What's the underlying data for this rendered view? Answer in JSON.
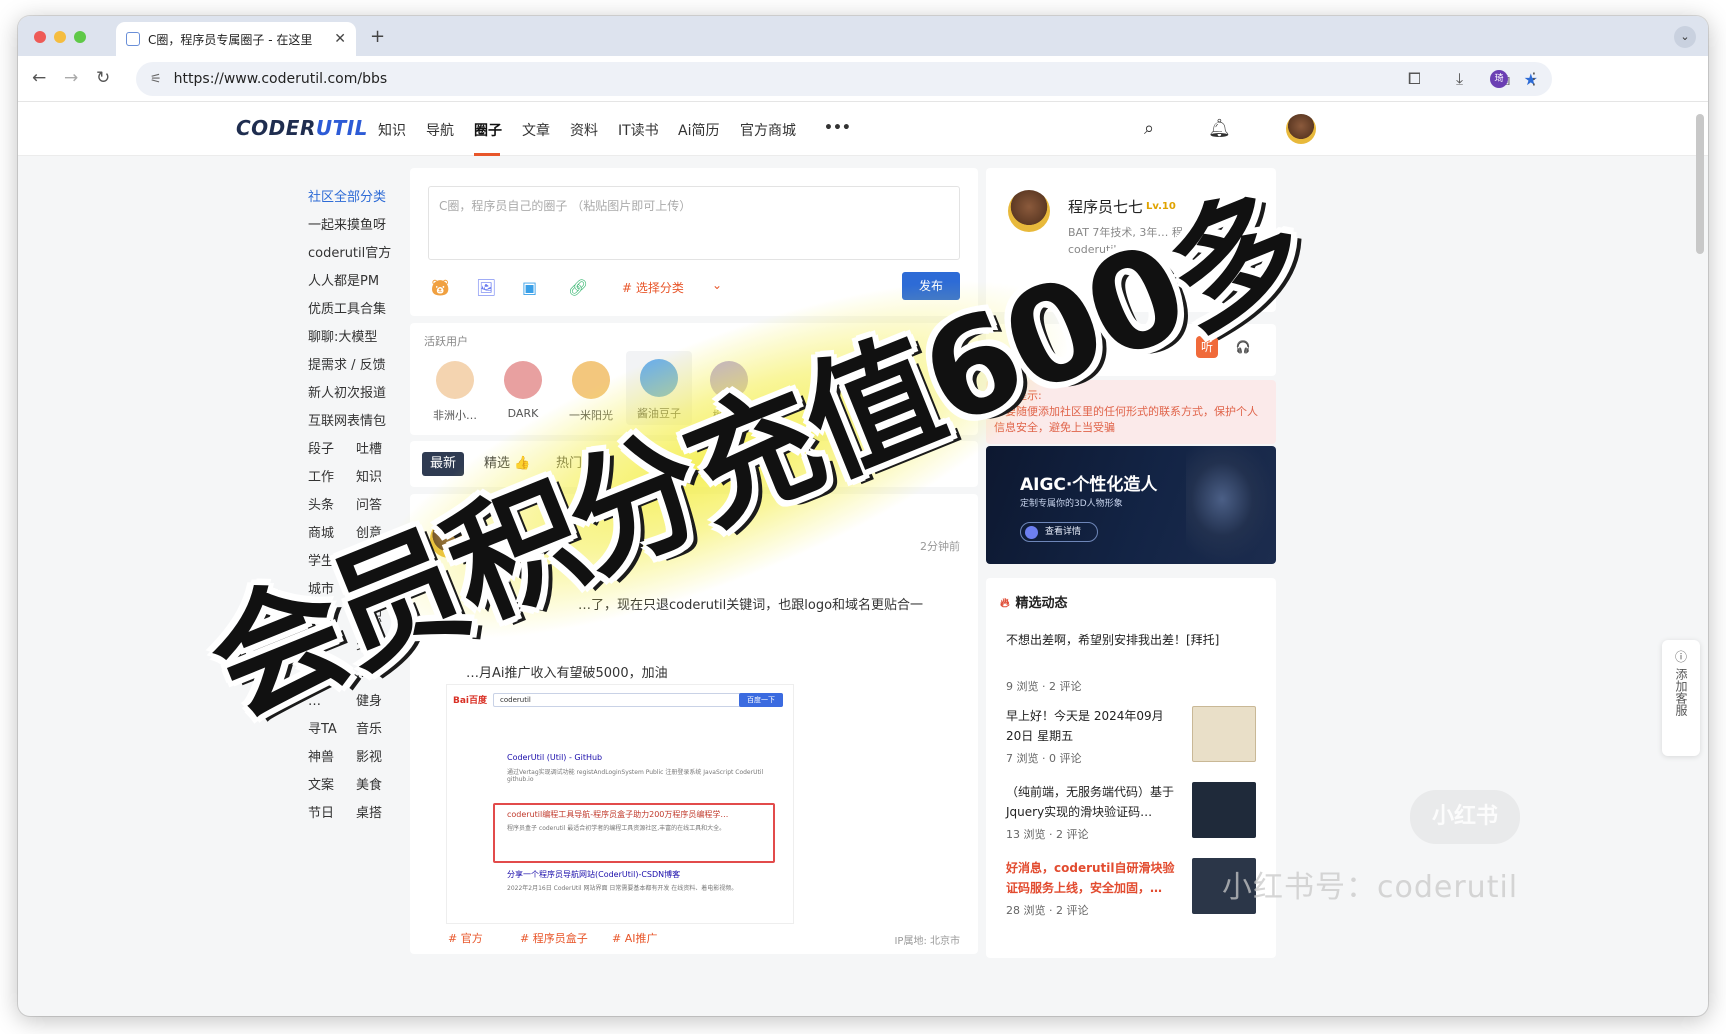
{
  "browser": {
    "tab_title": "C圈，程序员专属圈子 - 在这里",
    "tab_close": "✕",
    "new_tab": "+",
    "url": "https://www.coderutil.com/bbs",
    "profile_initial": "琦"
  },
  "site": {
    "logo_main": "CODER",
    "logo_accent": "UTIL",
    "nav": [
      "知识",
      "导航",
      "圈子",
      "文章",
      "资料",
      "IT读书",
      "Ai简历",
      "官方商城"
    ],
    "nav_more": "•••",
    "active_nav": "圈子"
  },
  "categories": {
    "title": "社区全部分类",
    "single": [
      "一起来摸鱼呀",
      "coderutil官方",
      "人人都是PM",
      "优质工具合集",
      "聊聊:大模型",
      "提需求 / 反馈",
      "新人初次报道",
      "互联网表情包"
    ],
    "pairs": [
      [
        "段子",
        "吐槽"
      ],
      [
        "工作",
        "知识"
      ],
      [
        "头条",
        "问答"
      ],
      [
        "商城",
        "创意"
      ],
      [
        "学生",
        "职场"
      ],
      [
        "城市",
        "脱…"
      ],
      [
        "…",
        "求职"
      ],
      [
        "…",
        "交易"
      ],
      [
        "…",
        "…"
      ],
      [
        "…",
        "健身"
      ],
      [
        "寻TA",
        "音乐"
      ],
      [
        "神兽",
        "影视"
      ],
      [
        "文案",
        "美食"
      ],
      [
        "节日",
        "桌搭"
      ]
    ]
  },
  "compose": {
    "placeholder": "C圈，程序员自己的圈子 （粘贴图片即可上传）",
    "category": "# 选择分类",
    "caret": "⌄",
    "publish": "发布"
  },
  "active_users": {
    "title": "活跃用户",
    "users": [
      {
        "name": "非洲小…",
        "color": "#f4d4b0"
      },
      {
        "name": "DARK",
        "color": "#e8a0a0"
      },
      {
        "name": "一米阳光",
        "color": "#f3c77d"
      },
      {
        "name": "酱油豆子",
        "color": "#6fb0e8"
      },
      {
        "name": "榴莲…",
        "color": "#b7a6e0"
      }
    ]
  },
  "feed_tabs": [
    {
      "label": "最新",
      "active": true
    },
    {
      "label": "精选 👍",
      "active": false
    },
    {
      "label": "热门 🔥",
      "active": false
    }
  ],
  "post": {
    "time": "2分钟前",
    "line1": "…了，现在只退coderutil关键词，也跟logo和域名更贴合一",
    "line2": "…月Ai推广收入有望破5000，加油",
    "shot_query": "coderutil",
    "shot_button": "百度一下",
    "shot_logo": "Bai百度",
    "shot_results": [
      {
        "title": "CoderUtil (Util) - GitHub",
        "desc": "通过Vertag实现调试功能 registAndLoginSystem Public 注册登录系统 JavaScript CoderUtil github.io"
      },
      {
        "title": "coderutil编程工具导航-程序员盒子助力200万程序员编程学…",
        "desc": "程序员盒子 coderutil 最适合初学者的编程工具资源社区,丰富的在线工具和大全。"
      },
      {
        "title": "分享一个程序员导航网站(CoderUtil)-CSDN博客",
        "desc": "2022年2月16日 CoderUtil 网站界面 日常需要基本都有开发 在线资料、着电影视频。"
      }
    ],
    "tags": [
      "# 官方",
      "# 程序员盒子",
      "# AI推广"
    ],
    "ip": "IP属地: 北京市"
  },
  "profile": {
    "name": "程序员七七",
    "level": "Lv.10",
    "desc": "BAT 7年技术, 3年… 程序员盒子coderutil…"
  },
  "audio": {
    "listen": "听",
    "headphones": "🎧"
  },
  "notice": {
    "title": "温馨提示:",
    "text": "不要随便添加社区里的任何形式的联系方式，保护个人信息安全，避免上当受骗"
  },
  "banner": {
    "title": "AIGC·个性化造人",
    "subtitle": "定制专属你的3D人物形象",
    "button": "查看详情"
  },
  "digest": {
    "title": "精选动态",
    "items": [
      {
        "text": "不想出差啊，希望别安排我出差！[拜托]",
        "meta": "9 浏览 · 2 评论",
        "hot": false,
        "thumb": ""
      },
      {
        "text": "早上好！今天是 2024年09月20日 星期五",
        "meta": "7 浏览 · 0 评论",
        "hot": false,
        "thumb": "#e9dfc8"
      },
      {
        "text": "（纯前端，无服务端代码）基于Jquery实现的滑块验证码…",
        "meta": "13 浏览 · 2 评论",
        "hot": false,
        "thumb": "#1f2a3a"
      },
      {
        "text": "好消息，coderutil自研滑块验证码服务上线，安全加固，…",
        "meta": "28 浏览 · 2 评论",
        "hot": true,
        "thumb": "#2b3648"
      }
    ]
  },
  "side_service": "添加客服",
  "overlay": {
    "headline": "会员积分充值600多",
    "watermark_logo": "小红书",
    "watermark_text": "小红书号：coderutil"
  }
}
